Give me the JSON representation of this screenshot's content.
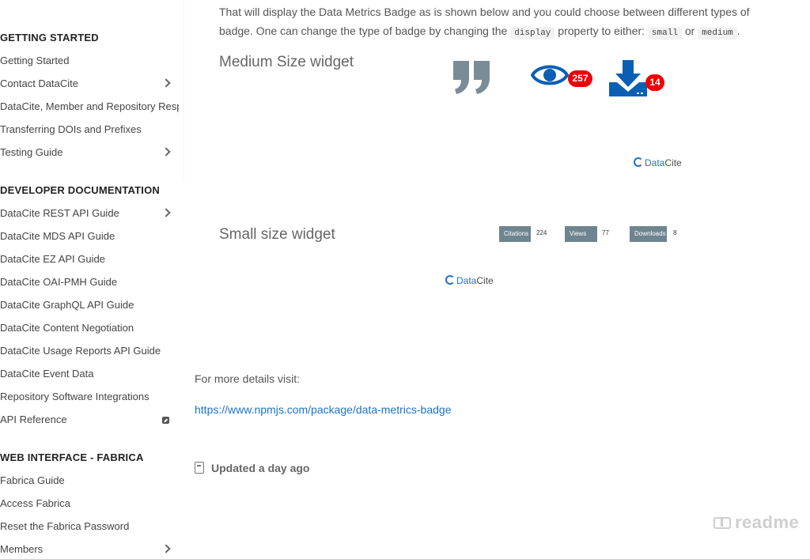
{
  "sidebar": {
    "sections": [
      {
        "title": "GETTING STARTED",
        "items": [
          {
            "label": "Getting Started",
            "chevron": false
          },
          {
            "label": "Contact DataCite",
            "chevron": true
          },
          {
            "label": "DataCite, Member and Repository Responsibilities",
            "chevron": false
          },
          {
            "label": "Transferring DOIs and Prefixes",
            "chevron": false
          },
          {
            "label": "Testing Guide",
            "chevron": true
          }
        ]
      },
      {
        "title": "DEVELOPER DOCUMENTATION",
        "items": [
          {
            "label": "DataCite REST API Guide",
            "chevron": true
          },
          {
            "label": "DataCite MDS API Guide",
            "chevron": false
          },
          {
            "label": "DataCite EZ API Guide",
            "chevron": false
          },
          {
            "label": "DataCite OAI-PMH Guide",
            "chevron": false
          },
          {
            "label": "DataCite GraphQL API Guide",
            "chevron": false
          },
          {
            "label": "DataCite Content Negotiation",
            "chevron": false
          },
          {
            "label": "DataCite Usage Reports API Guide",
            "chevron": false
          },
          {
            "label": "DataCite Event Data",
            "chevron": false
          },
          {
            "label": "Repository Software Integrations",
            "chevron": false
          },
          {
            "label": "API Reference",
            "chevron": false,
            "external": true
          }
        ]
      },
      {
        "title": "WEB INTERFACE - FABRICA",
        "items": [
          {
            "label": "Fabrica Guide",
            "chevron": false
          },
          {
            "label": "Access Fabrica",
            "chevron": false
          },
          {
            "label": "Reset the Fabrica Password",
            "chevron": false
          },
          {
            "label": "Members",
            "chevron": true
          }
        ]
      }
    ]
  },
  "main": {
    "intro": {
      "line1": "That will display the Data Metrics Badge as is shown below and you could choose between different types of",
      "line2_pre": "badge. One can change the type of badge by changing the",
      "code_display": "display",
      "line2_mid": "property to either:",
      "code_small": "small",
      "or": "or",
      "code_medium": "medium",
      "period": "."
    },
    "medium_heading": "Medium Size widget",
    "medium_widget": {
      "views_count": "257",
      "downloads_count": "14",
      "icons": [
        "quote-icon",
        "eye-icon",
        "download-icon"
      ],
      "accent": "#0a5fb4",
      "badge_color": "#e00000"
    },
    "small_heading": "Small size widget",
    "small_widget": {
      "badges": [
        {
          "label": "Citations",
          "count": "224"
        },
        {
          "label": "Views",
          "count": "77"
        },
        {
          "label": "Downloads",
          "count": "8"
        }
      ],
      "badge_color": "#6e8590"
    },
    "logo": {
      "data": "Data",
      "cite": "Cite"
    },
    "details_text": "For more details visit:",
    "link_text": "https://www.npmjs.com/package/data-metrics-badge",
    "updated_text": "Updated a day ago",
    "footer_brand": "readme"
  }
}
